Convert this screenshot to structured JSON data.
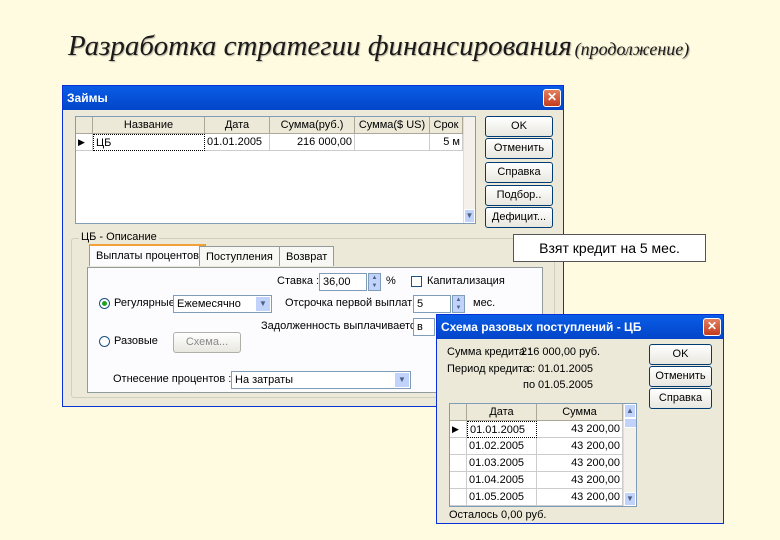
{
  "slide": {
    "title": "Разработка стратегии финансирования",
    "subtitle": "(продолжение)"
  },
  "loans_window": {
    "title": "Займы",
    "close_label": "✕",
    "columns": [
      "Название",
      "Дата",
      "Сумма(руб.)",
      "Сумма($ US)",
      "Срок"
    ],
    "rows": [
      {
        "name": "ЦБ",
        "date": "01.01.2005",
        "amount_rub": "216 000,00",
        "amount_usd": "",
        "term": "5 м"
      }
    ],
    "buttons": {
      "ok": "OK",
      "cancel": "Отменить",
      "help": "Справка",
      "select": "Подбор..",
      "deficit": "Дефицит..."
    },
    "description_group": "ЦБ - Описание",
    "tabs": [
      "Выплаты процентов",
      "Поступления",
      "Возврат"
    ],
    "rate_label": "Ставка :",
    "rate_value": "36,00",
    "percent_sign": "%",
    "capitalization_label": "Капитализация",
    "regular_label": "Регулярные",
    "periodicity_value": "Ежемесячно",
    "delay_label": "Отсрочка первой выплаты",
    "delay_value": "5",
    "delay_unit": "мес.",
    "debt_paid_label": "Задолженность выплачивается",
    "debt_paid_value": "в",
    "onetime_label": "Разовые",
    "scheme_button": "Схема...",
    "interest_relation_label": "Отнесение процентов :",
    "interest_relation_value": "На затраты"
  },
  "callout": {
    "text": "Взят кредит на 5 мес."
  },
  "scheme_window": {
    "title": "Схема разовых поступлений - ЦБ",
    "close_label": "✕",
    "credit_sum_label": "Сумма кредита :",
    "credit_sum_value": "216 000,00 руб.",
    "period_label": "Период кредита :",
    "period_from_label": "с",
    "period_from_value": "01.01.2005",
    "period_to_label": "по",
    "period_to_value": "01.05.2005",
    "buttons": {
      "ok": "OK",
      "cancel": "Отменить",
      "help": "Справка"
    },
    "columns": [
      "Дата",
      "Сумма"
    ],
    "rows": [
      {
        "date": "01.01.2005",
        "amount": "43 200,00"
      },
      {
        "date": "01.02.2005",
        "amount": "43 200,00"
      },
      {
        "date": "01.03.2005",
        "amount": "43 200,00"
      },
      {
        "date": "01.04.2005",
        "amount": "43 200,00"
      },
      {
        "date": "01.05.2005",
        "amount": "43 200,00"
      }
    ],
    "remaining_label": "Осталось 0,00 руб."
  },
  "icons": {
    "row_pointer": "▶",
    "dropdown": "▼",
    "scroll_up": "▲",
    "scroll_down": "▼"
  },
  "colors": {
    "titlebar": "#0a5de6",
    "window_bg": "#ece9d8",
    "close_button": "#d4583a",
    "slide_bg": "#fffbe0"
  }
}
